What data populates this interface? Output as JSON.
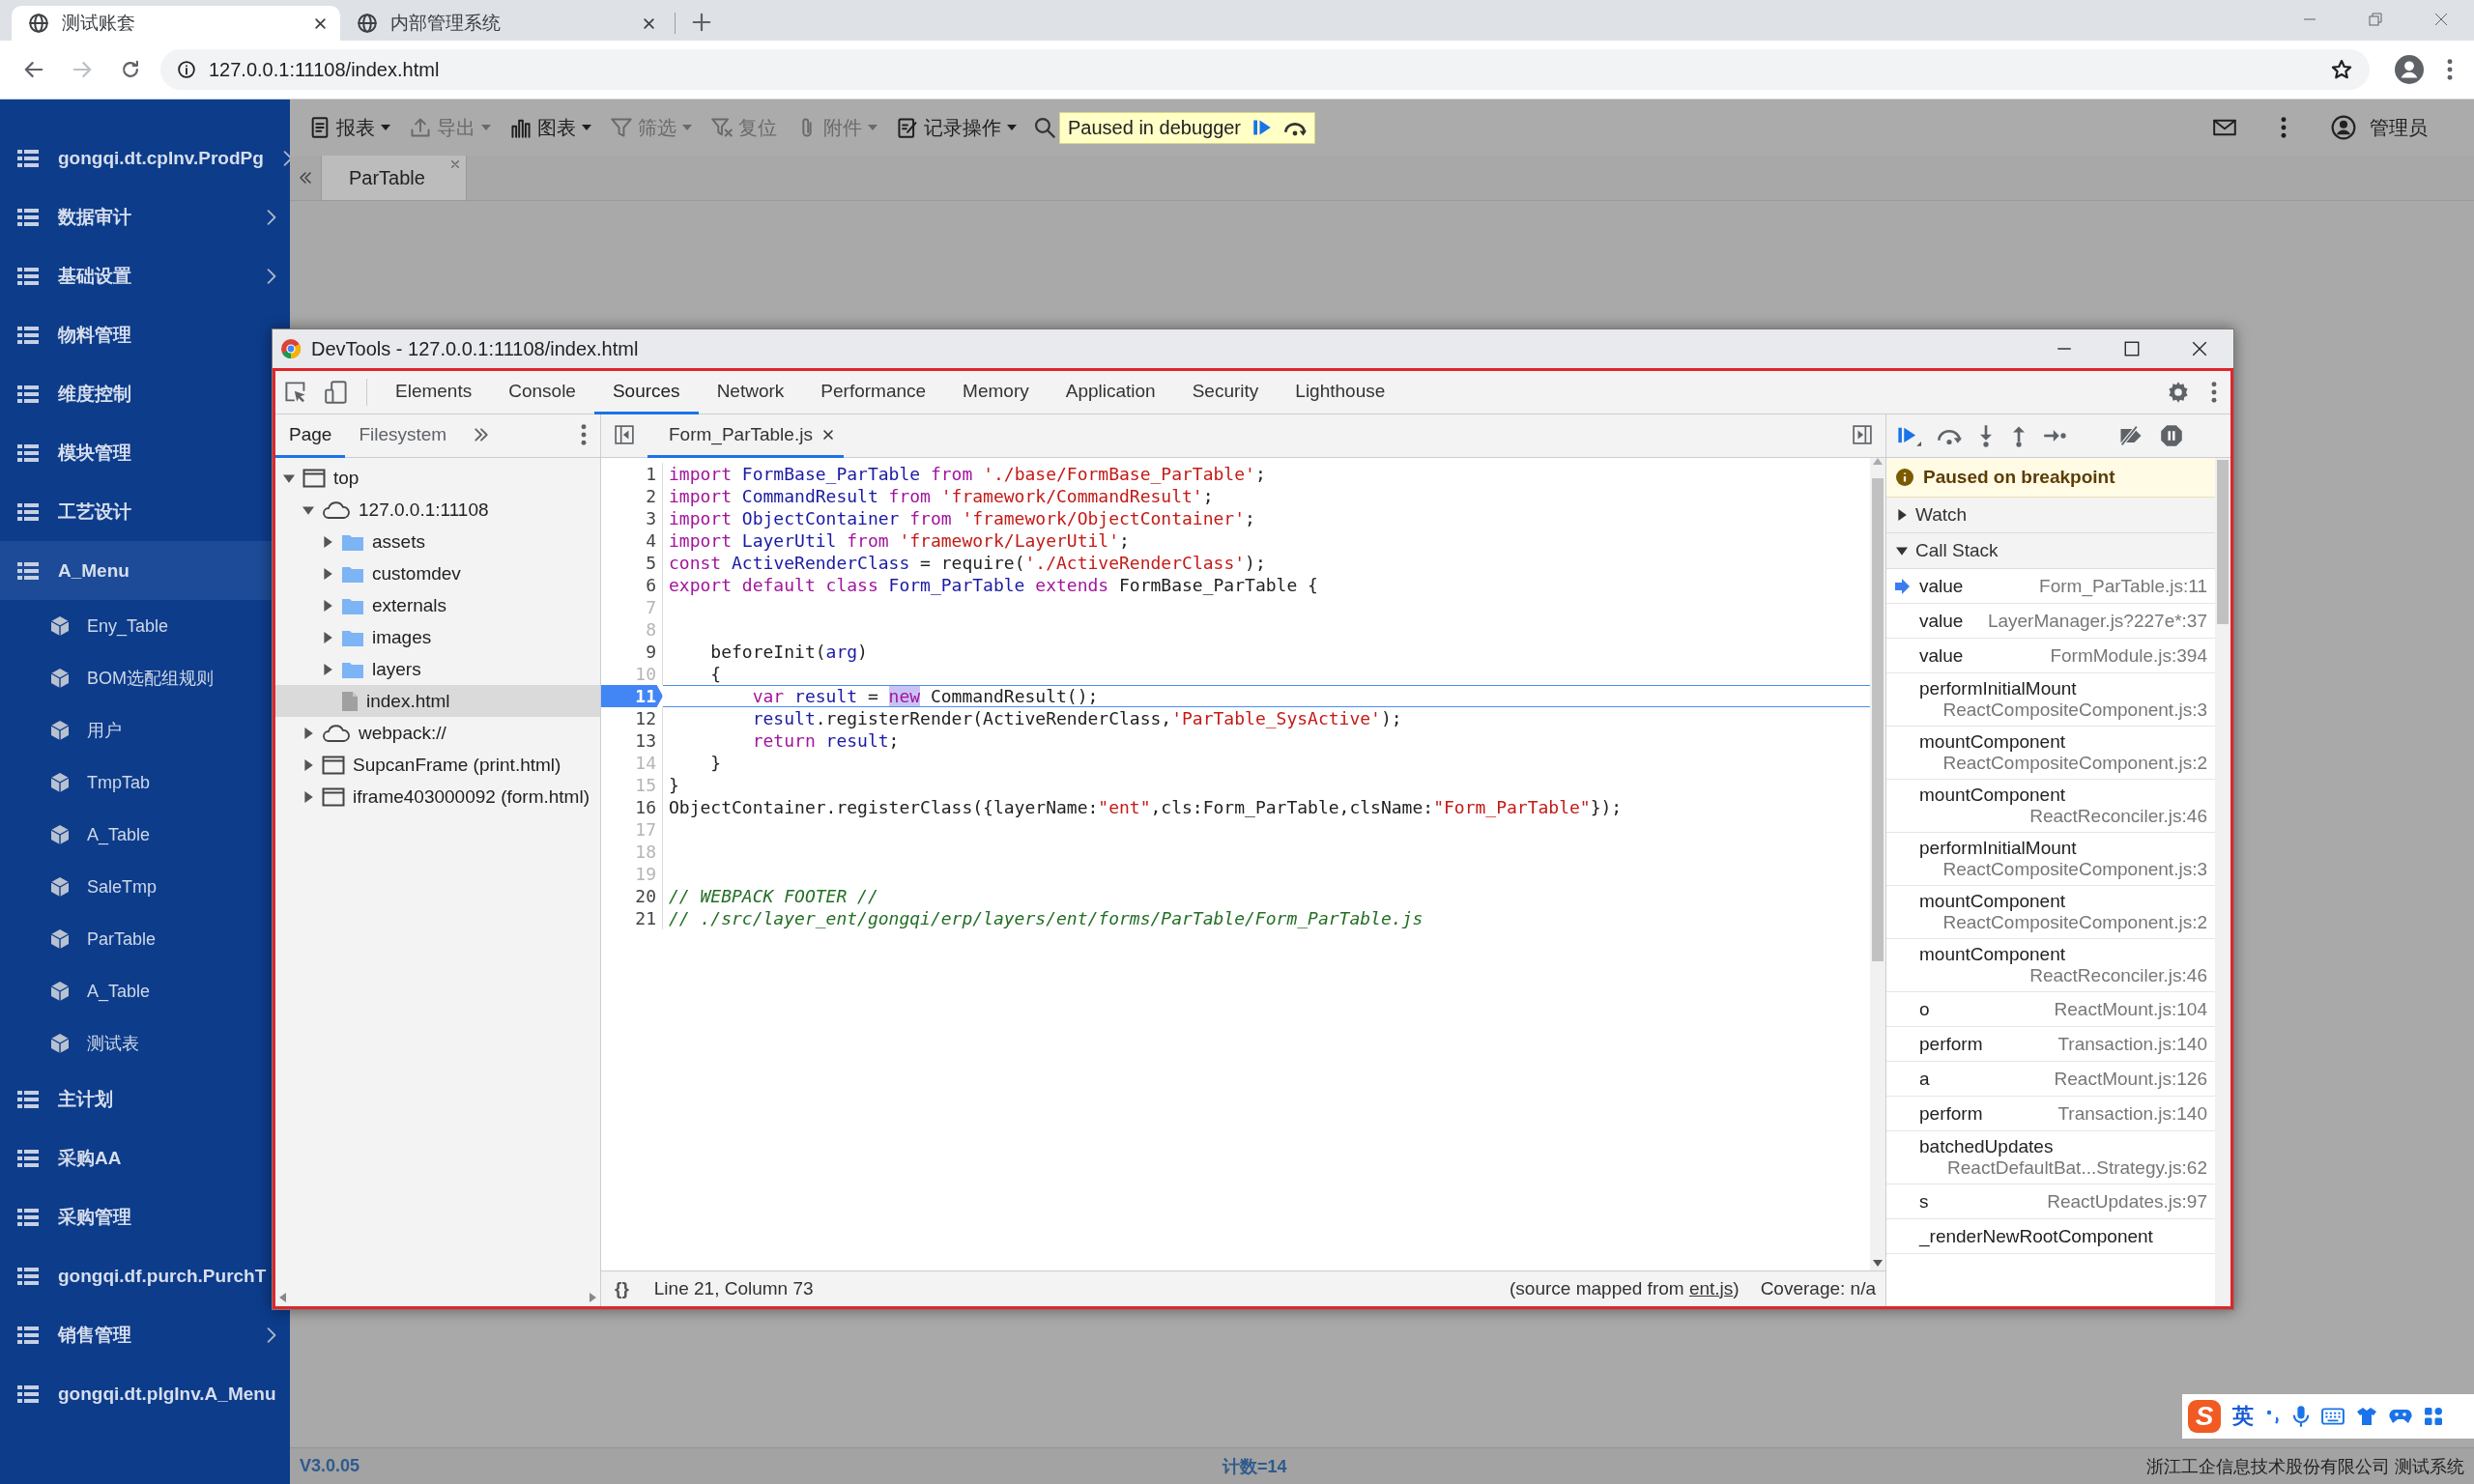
{
  "browser": {
    "tabs": [
      {
        "title": "测试账套",
        "selected": true
      },
      {
        "title": "内部管理系统",
        "selected": false
      }
    ],
    "address": "127.0.0.1:11108/index.html"
  },
  "sidebar": {
    "items": [
      {
        "label": "gongqi.dt.cpInv.ProdPg",
        "submenu": true,
        "selected": false
      },
      {
        "label": "数据审计",
        "submenu": true,
        "selected": false
      },
      {
        "label": "基础设置",
        "submenu": true,
        "selected": false
      },
      {
        "label": "物料管理",
        "submenu": false,
        "selected": false
      },
      {
        "label": "维度控制",
        "submenu": false,
        "selected": false
      },
      {
        "label": "模块管理",
        "submenu": false,
        "selected": false
      },
      {
        "label": "工艺设计",
        "submenu": false,
        "selected": false
      },
      {
        "label": "A_Menu",
        "submenu": false,
        "selected": true,
        "children": [
          {
            "label": "Eny_Table",
            "selected": false
          },
          {
            "label": "BOM选配组规则",
            "selected": false
          },
          {
            "label": "用户",
            "selected": false
          },
          {
            "label": "TmpTab",
            "selected": false
          },
          {
            "label": "A_Table",
            "selected": false
          },
          {
            "label": "SaleTmp",
            "selected": false
          },
          {
            "label": "ParTable",
            "selected": false
          },
          {
            "label": "A_Table",
            "selected": false
          },
          {
            "label": "测试表",
            "selected": false
          }
        ]
      },
      {
        "label": "主计划",
        "submenu": false,
        "selected": false
      },
      {
        "label": "采购AA",
        "submenu": false,
        "selected": false
      },
      {
        "label": "采购管理",
        "submenu": false,
        "selected": false
      },
      {
        "label": "gongqi.df.purch.PurchT",
        "submenu": false,
        "selected": false
      },
      {
        "label": "销售管理",
        "submenu": true,
        "selected": false
      },
      {
        "label": "gongqi.dt.plgInv.A_Menu",
        "submenu": false,
        "selected": false
      }
    ]
  },
  "toolbar": {
    "items": [
      {
        "label": "报表",
        "dropdown": true,
        "disabled": false
      },
      {
        "label": "导出",
        "dropdown": true,
        "disabled": true
      },
      {
        "label": "图表",
        "dropdown": true,
        "disabled": false
      },
      {
        "label": "筛选",
        "dropdown": true,
        "disabled": true
      },
      {
        "label": "复位",
        "dropdown": false,
        "disabled": true
      },
      {
        "label": "附件",
        "dropdown": true,
        "disabled": true
      },
      {
        "label": "记录操作",
        "dropdown": true,
        "disabled": false
      }
    ],
    "debugger_banner": "Paused in debugger",
    "user": "管理员"
  },
  "page_tabs": [
    {
      "label": "ParTable",
      "selected": true
    }
  ],
  "devtools": {
    "title": "DevTools - 127.0.0.1:11108/index.html",
    "tabs": [
      {
        "label": "Elements",
        "selected": false
      },
      {
        "label": "Console",
        "selected": false
      },
      {
        "label": "Sources",
        "selected": true
      },
      {
        "label": "Network",
        "selected": false
      },
      {
        "label": "Performance",
        "selected": false
      },
      {
        "label": "Memory",
        "selected": false
      },
      {
        "label": "Application",
        "selected": false
      },
      {
        "label": "Security",
        "selected": false
      },
      {
        "label": "Lighthouse",
        "selected": false
      }
    ],
    "navigator": {
      "tabs": [
        {
          "label": "Page",
          "selected": true
        },
        {
          "label": "Filesystem",
          "selected": false
        }
      ],
      "tree": [
        {
          "label": "top",
          "kind": "frame",
          "expanded": true,
          "selected": false,
          "children": [
            {
              "label": "127.0.0.1:11108",
              "kind": "origin",
              "expanded": true,
              "selected": false,
              "children": [
                {
                  "label": "assets",
                  "kind": "folder",
                  "expanded": false,
                  "selected": false
                },
                {
                  "label": "customdev",
                  "kind": "folder",
                  "expanded": false,
                  "selected": false
                },
                {
                  "label": "externals",
                  "kind": "folder",
                  "expanded": false,
                  "selected": false
                },
                {
                  "label": "images",
                  "kind": "folder",
                  "expanded": false,
                  "selected": false
                },
                {
                  "label": "layers",
                  "kind": "folder",
                  "expanded": false,
                  "selected": false
                },
                {
                  "label": "index.html",
                  "kind": "file",
                  "selected": true
                }
              ]
            },
            {
              "label": "webpack://",
              "kind": "origin",
              "expanded": false,
              "selected": false
            },
            {
              "label": "SupcanFrame (print.html)",
              "kind": "frame",
              "expanded": false,
              "selected": false
            },
            {
              "label": "iframe403000092 (form.html)",
              "kind": "frame",
              "expanded": false,
              "selected": false
            }
          ]
        }
      ]
    },
    "editor": {
      "file": "Form_ParTable.js",
      "lines": [
        {
          "number": "1",
          "mapped": true,
          "breakpoint": false,
          "tokens": [
            {
              "kind": "keyword",
              "text": "import "
            },
            {
              "kind": "name",
              "text": "FormBase_ParTable "
            },
            {
              "kind": "keyword",
              "text": "from "
            },
            {
              "kind": "string",
              "text": "'./base/FormBase_ParTable'"
            },
            {
              "kind": "plain",
              "text": ";"
            }
          ]
        },
        {
          "number": "2",
          "mapped": true,
          "breakpoint": false,
          "tokens": [
            {
              "kind": "keyword",
              "text": "import "
            },
            {
              "kind": "name",
              "text": "CommandResult "
            },
            {
              "kind": "keyword",
              "text": "from "
            },
            {
              "kind": "string",
              "text": "'framework/CommandResult'"
            },
            {
              "kind": "plain",
              "text": ";"
            }
          ]
        },
        {
          "number": "3",
          "mapped": true,
          "breakpoint": false,
          "tokens": [
            {
              "kind": "keyword",
              "text": "import "
            },
            {
              "kind": "name",
              "text": "ObjectContainer "
            },
            {
              "kind": "keyword",
              "text": "from "
            },
            {
              "kind": "string",
              "text": "'framework/ObjectContainer'"
            },
            {
              "kind": "plain",
              "text": ";"
            }
          ]
        },
        {
          "number": "4",
          "mapped": true,
          "breakpoint": false,
          "tokens": [
            {
              "kind": "keyword",
              "text": "import "
            },
            {
              "kind": "name",
              "text": "LayerUtil "
            },
            {
              "kind": "keyword",
              "text": "from "
            },
            {
              "kind": "string",
              "text": "'framework/LayerUtil'"
            },
            {
              "kind": "plain",
              "text": ";"
            }
          ]
        },
        {
          "number": "5",
          "mapped": true,
          "breakpoint": false,
          "tokens": [
            {
              "kind": "keyword",
              "text": "const "
            },
            {
              "kind": "name",
              "text": "ActiveRenderClass "
            },
            {
              "kind": "plain",
              "text": "= require("
            },
            {
              "kind": "string",
              "text": "'./ActiveRenderClass'"
            },
            {
              "kind": "plain",
              "text": ");"
            }
          ]
        },
        {
          "number": "6",
          "mapped": true,
          "breakpoint": false,
          "tokens": [
            {
              "kind": "keyword",
              "text": "export default class "
            },
            {
              "kind": "name",
              "text": "Form_ParTable "
            },
            {
              "kind": "keyword",
              "text": "extends "
            },
            {
              "kind": "plain",
              "text": "FormBase_ParTable {"
            }
          ]
        },
        {
          "number": "7",
          "mapped": false,
          "breakpoint": false
        },
        {
          "number": "8",
          "mapped": false,
          "breakpoint": false
        },
        {
          "number": "9",
          "mapped": true,
          "breakpoint": false,
          "tokens": [
            {
              "kind": "plain",
              "text": "    beforeInit("
            },
            {
              "kind": "name",
              "text": "arg"
            },
            {
              "kind": "plain",
              "text": ")"
            }
          ]
        },
        {
          "number": "10",
          "mapped": false,
          "breakpoint": false,
          "tokens": [
            {
              "kind": "plain",
              "text": "    {"
            }
          ]
        },
        {
          "number": "11",
          "mapped": true,
          "breakpoint": true,
          "tokens": [
            {
              "kind": "keyword",
              "text": "        var "
            },
            {
              "kind": "name",
              "text": "result "
            },
            {
              "kind": "plain",
              "text": "= "
            },
            {
              "kind": "current",
              "text": "new"
            },
            {
              "kind": "plain",
              "text": " CommandResult();"
            }
          ]
        },
        {
          "number": "12",
          "mapped": true,
          "breakpoint": false,
          "tokens": [
            {
              "kind": "name",
              "text": "        result"
            },
            {
              "kind": "plain",
              "text": ".registerRender(ActiveRenderClass,"
            },
            {
              "kind": "string",
              "text": "'ParTable_SysActive'"
            },
            {
              "kind": "plain",
              "text": ");"
            }
          ]
        },
        {
          "number": "13",
          "mapped": true,
          "breakpoint": false,
          "tokens": [
            {
              "kind": "keyword",
              "text": "        return "
            },
            {
              "kind": "name",
              "text": "result"
            },
            {
              "kind": "plain",
              "text": ";"
            }
          ]
        },
        {
          "number": "14",
          "mapped": false,
          "breakpoint": false,
          "tokens": [
            {
              "kind": "plain",
              "text": "    }"
            }
          ]
        },
        {
          "number": "15",
          "mapped": false,
          "breakpoint": false,
          "tokens": [
            {
              "kind": "plain",
              "text": "}"
            }
          ]
        },
        {
          "number": "16",
          "mapped": true,
          "breakpoint": false,
          "tokens": [
            {
              "kind": "plain",
              "text": "ObjectContainer.registerClass({layerName:"
            },
            {
              "kind": "string",
              "text": "\"ent\""
            },
            {
              "kind": "plain",
              "text": ",cls:Form_ParTable,clsName:"
            },
            {
              "kind": "string",
              "text": "\"Form_ParTable\""
            },
            {
              "kind": "plain",
              "text": "});"
            }
          ]
        },
        {
          "number": "17",
          "mapped": false,
          "breakpoint": false
        },
        {
          "number": "18",
          "mapped": false,
          "breakpoint": false
        },
        {
          "number": "19",
          "mapped": false,
          "breakpoint": false
        },
        {
          "number": "20",
          "mapped": true,
          "breakpoint": false,
          "tokens": [
            {
              "kind": "comment",
              "text": "// WEBPACK FOOTER //"
            }
          ]
        },
        {
          "number": "21",
          "mapped": true,
          "breakpoint": false,
          "tokens": [
            {
              "kind": "comment",
              "text": "// ./src/layer_ent/gongqi/erp/layers/ent/forms/ParTable/Form_ParTable.js"
            }
          ]
        }
      ],
      "status": {
        "pretty_print": "{}",
        "cursor": "Line 21, Column 73",
        "source_before": "(source mapped from ",
        "source_link": "ent.js",
        "source_after": ")",
        "coverage": "Coverage: n/a"
      }
    },
    "debugger": {
      "banner": "Paused on breakpoint",
      "sections": [
        {
          "title": "Watch",
          "expanded": false
        },
        {
          "title": "Call Stack",
          "expanded": true
        }
      ],
      "frames": [
        {
          "function": "value",
          "location": "Form_ParTable.js:11",
          "selected": true
        },
        {
          "function": "value",
          "location": "LayerManager.js?227e*:37",
          "selected": false
        },
        {
          "function": "value",
          "location": "FormModule.js:394",
          "selected": false
        },
        {
          "function": "performInitialMount",
          "location": "ReactCompositeComponent.js:3",
          "selected": false
        },
        {
          "function": "mountComponent",
          "location": "ReactCompositeComponent.js:2",
          "selected": false
        },
        {
          "function": "mountComponent",
          "location": "ReactReconciler.js:46",
          "selected": false
        },
        {
          "function": "performInitialMount",
          "location": "ReactCompositeComponent.js:3",
          "selected": false
        },
        {
          "function": "mountComponent",
          "location": "ReactCompositeComponent.js:2",
          "selected": false
        },
        {
          "function": "mountComponent",
          "location": "ReactReconciler.js:46",
          "selected": false
        },
        {
          "function": "o",
          "location": "ReactMount.js:104",
          "selected": false
        },
        {
          "function": "perform",
          "location": "Transaction.js:140",
          "selected": false
        },
        {
          "function": "a",
          "location": "ReactMount.js:126",
          "selected": false
        },
        {
          "function": "perform",
          "location": "Transaction.js:140",
          "selected": false
        },
        {
          "function": "batchedUpdates",
          "location": "ReactDefaultBat...Strategy.js:62",
          "selected": false
        },
        {
          "function": "s",
          "location": "ReactUpdates.js:97",
          "selected": false
        },
        {
          "function": "_renderNewRootComponent",
          "selected": false
        }
      ]
    }
  },
  "ime": {
    "logo": "S",
    "mode": "英"
  },
  "status_bar": {
    "version": "V3.0.05",
    "count": "计数=14",
    "company": "浙江工企信息技术股份有限公司 测试系统"
  }
}
